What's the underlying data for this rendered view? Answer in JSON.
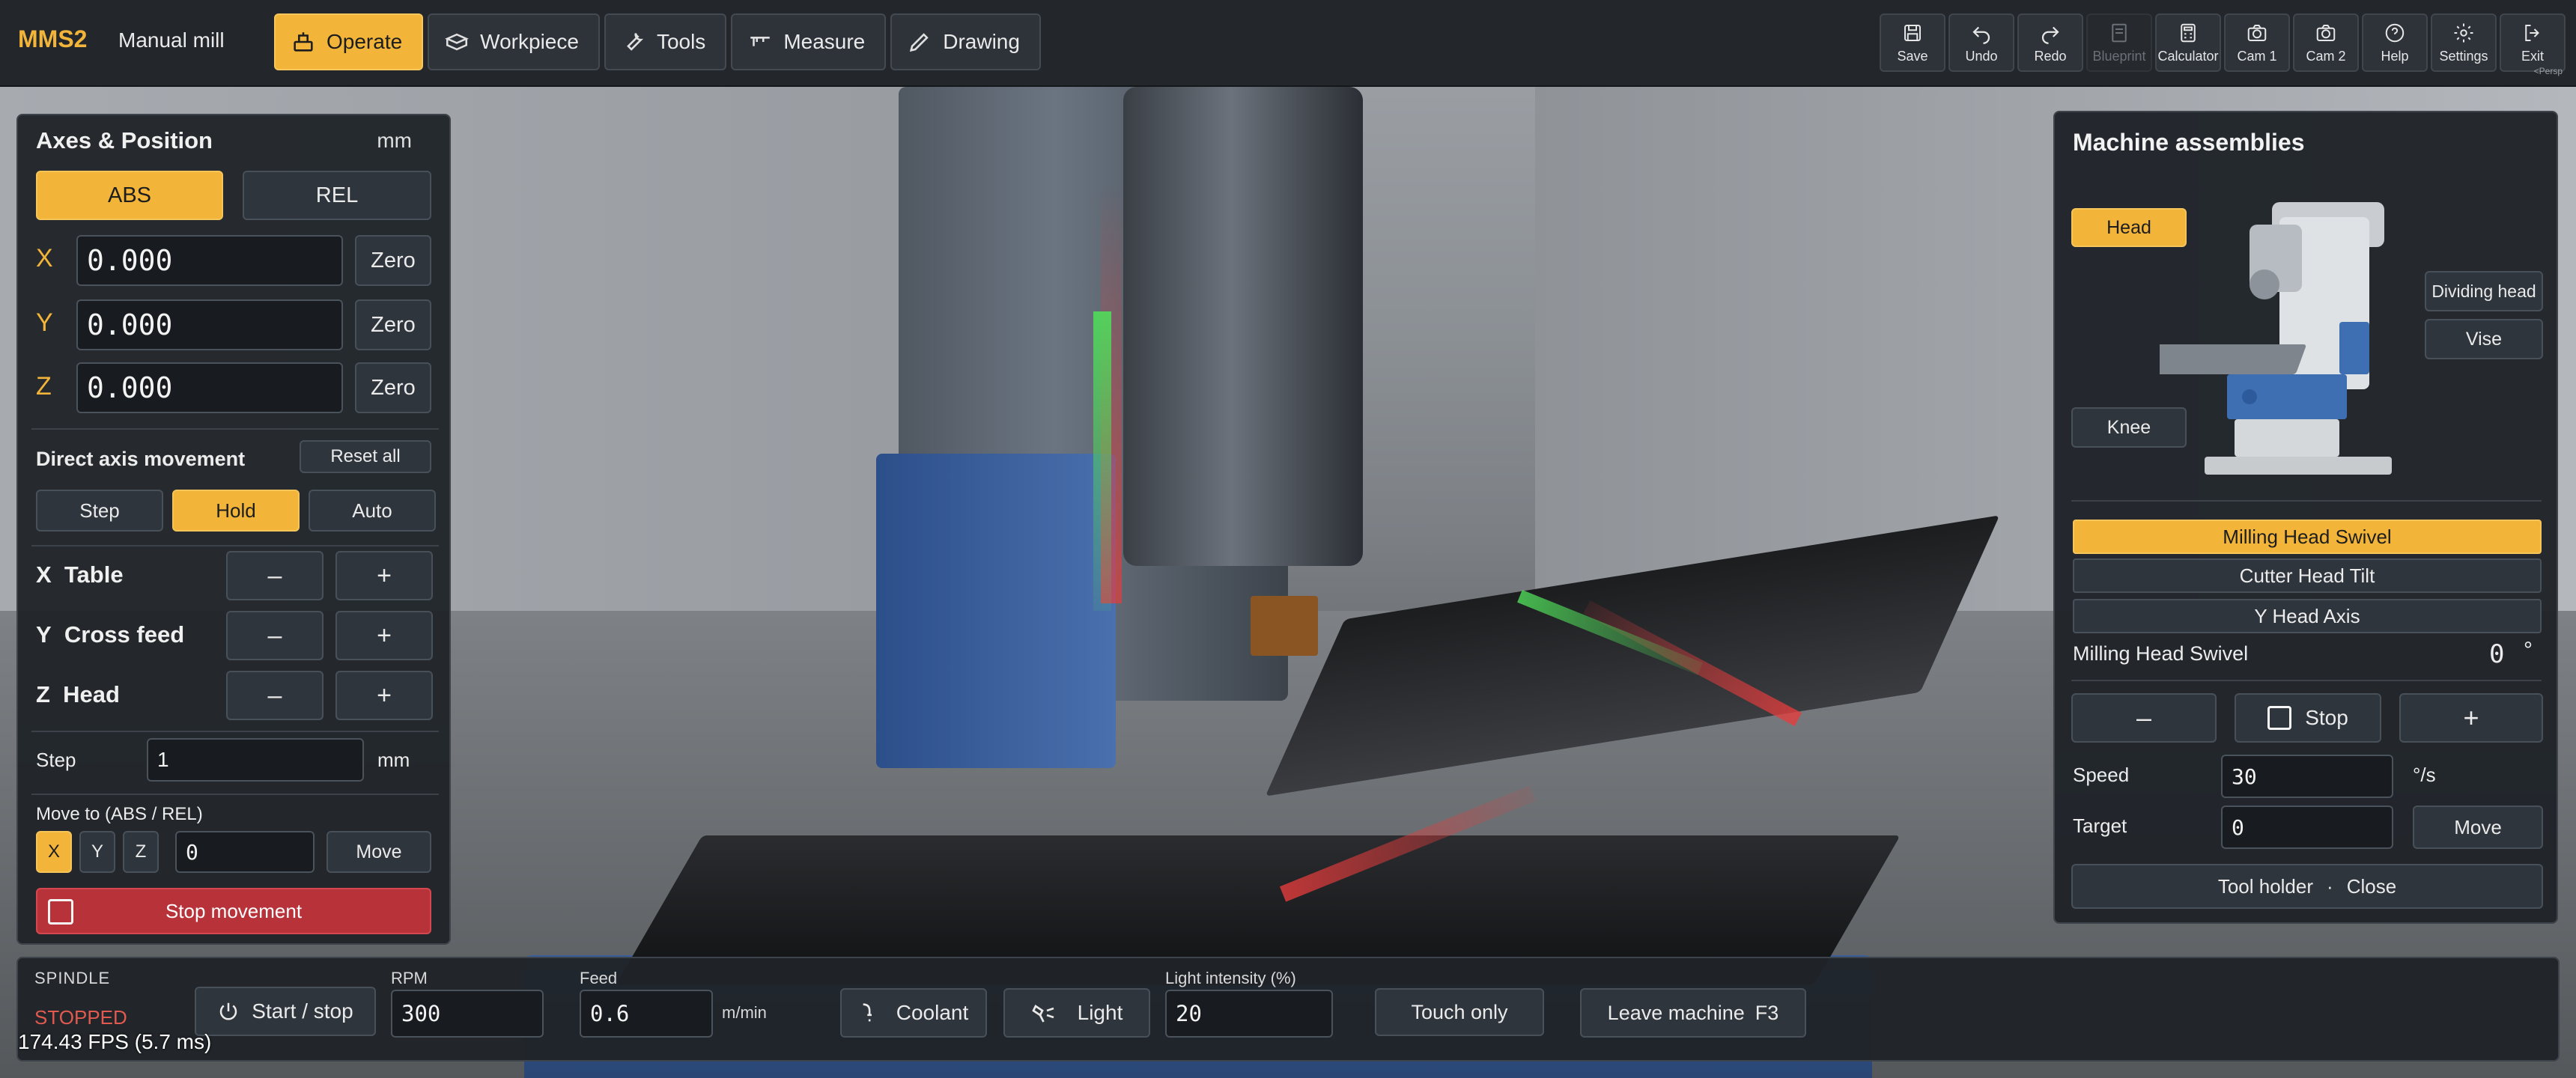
{
  "app": {
    "brand": "MMS2",
    "mode": "Manual mill"
  },
  "tabs": [
    {
      "label": "Operate",
      "icon": "operate-icon",
      "active": true
    },
    {
      "label": "Workpiece",
      "icon": "cube-icon",
      "active": false
    },
    {
      "label": "Tools",
      "icon": "wrench-icon",
      "active": false
    },
    {
      "label": "Measure",
      "icon": "caliper-icon",
      "active": false
    },
    {
      "label": "Drawing",
      "icon": "pencil-icon",
      "active": false
    }
  ],
  "toolbar": {
    "save": "Save",
    "undo": "Undo",
    "redo": "Redo",
    "blueprint": "Blueprint",
    "calculator": "Calculator",
    "cam1": "Cam 1",
    "cam2": "Cam 2",
    "help": "Help",
    "settings": "Settings",
    "exit": "Exit",
    "persp": "<Persp"
  },
  "axes": {
    "title": "Axes & Position",
    "unit": "mm",
    "abs": "ABS",
    "rel": "REL",
    "rows": [
      {
        "axis": "X",
        "value": "0.000",
        "zero": "Zero"
      },
      {
        "axis": "Y",
        "value": "0.000",
        "zero": "Zero"
      },
      {
        "axis": "Z",
        "value": "0.000",
        "zero": "Zero"
      }
    ],
    "direct_title": "Direct axis movement",
    "reset_all": "Reset all",
    "modes": [
      "Step",
      "Hold",
      "Auto"
    ],
    "active_mode": "Hold",
    "jog": [
      {
        "axis": "X",
        "name": "Table"
      },
      {
        "axis": "Y",
        "name": "Cross feed"
      },
      {
        "axis": "Z",
        "name": "Head"
      }
    ],
    "minus": "–",
    "plus": "+",
    "step_label": "Step",
    "step_value": "1",
    "step_unit": "mm",
    "move_to_label": "Move to (ABS / REL)",
    "move_axes": [
      "X",
      "Y",
      "Z"
    ],
    "move_value": "0",
    "move_button": "Move",
    "stop_movement": "Stop movement"
  },
  "assemblies": {
    "title": "Machine assemblies",
    "callouts": {
      "head": "Head",
      "dividing_head": "Dividing head",
      "vise": "Vise",
      "knee": "Knee"
    },
    "list": [
      {
        "label": "Milling Head Swivel",
        "active": true
      },
      {
        "label": "Cutter Head Tilt",
        "active": false
      },
      {
        "label": "Y Head Axis",
        "active": false
      }
    ],
    "readout_label": "Milling Head Swivel",
    "readout_value": "0",
    "readout_unit": "°",
    "minus": "–",
    "stop": "Stop",
    "plus": "+",
    "speed_label": "Speed",
    "speed_value": "30",
    "speed_unit": "°/s",
    "target_label": "Target",
    "target_value": "0",
    "move": "Move",
    "footer_left": "Tool holder",
    "footer_sep": "·",
    "footer_right": "Close"
  },
  "spindle": {
    "label": "SPINDLE",
    "status": "STOPPED",
    "start_stop": "Start / stop",
    "rpm_label": "RPM",
    "rpm_value": "300",
    "feed_label": "Feed",
    "feed_value": "0.6",
    "feed_unit": "m/min",
    "coolant": "Coolant",
    "light": "Light",
    "light_label": "Light intensity (%)",
    "light_value": "20",
    "touch_only": "Touch only",
    "leave_machine": "Leave machine",
    "leave_key": "F3"
  },
  "fps": "174.43 FPS (5.7 ms)",
  "colors": {
    "accent": "#f2b53a",
    "panel": "#202429",
    "stop_red": "#b8323a",
    "status_red": "#e05a4f"
  }
}
